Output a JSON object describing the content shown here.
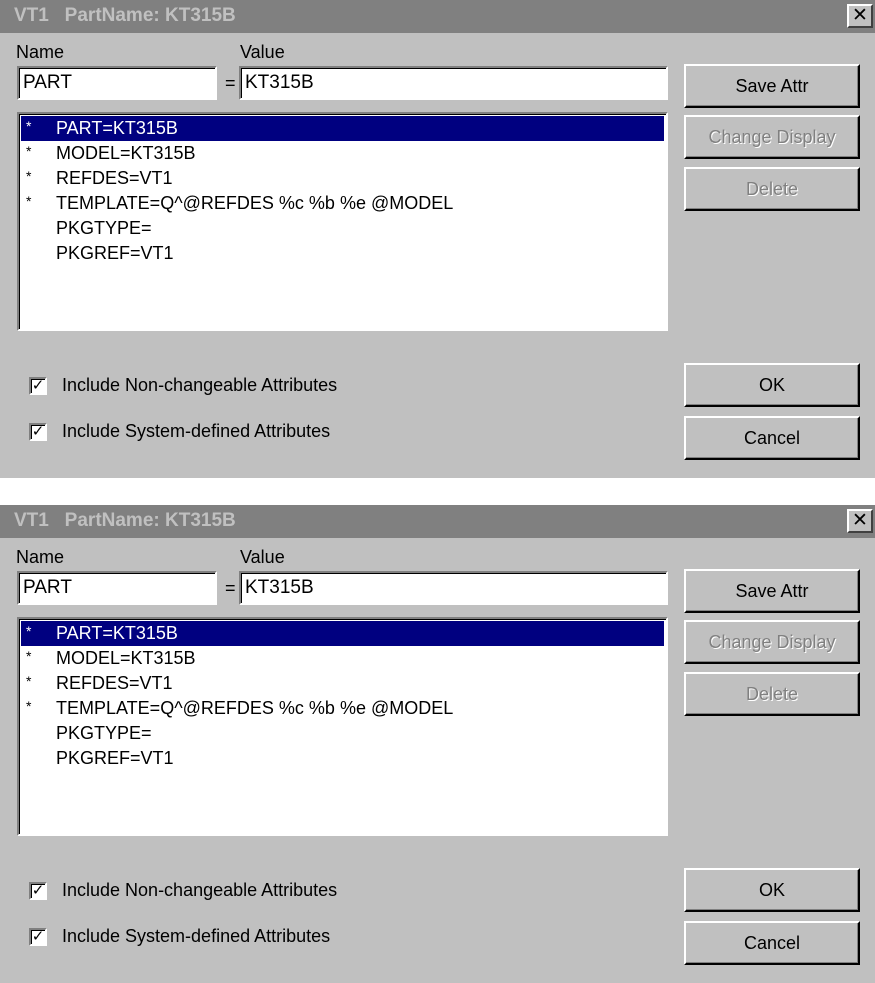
{
  "dialogs": [
    {
      "title": "VT1   PartName: KT315B",
      "close_glyph": "✕",
      "name_label": "Name",
      "value_label": "Value",
      "name_input": "PART",
      "equals": "=",
      "value_input": "KT315B",
      "attributes": [
        {
          "marker": "*",
          "text": "PART=KT315B",
          "selected": true
        },
        {
          "marker": "*",
          "text": "MODEL=KT315B",
          "selected": false
        },
        {
          "marker": "*",
          "text": "REFDES=VT1",
          "selected": false
        },
        {
          "marker": "*",
          "text": "TEMPLATE=Q^@REFDES %c %b %e @MODEL",
          "selected": false
        },
        {
          "marker": "",
          "text": "PKGTYPE=",
          "selected": false
        },
        {
          "marker": "",
          "text": "PKGREF=VT1",
          "selected": false
        }
      ],
      "buttons": {
        "save_attr": "Save Attr",
        "change_display": "Change Display",
        "delete": "Delete",
        "ok": "OK",
        "cancel": "Cancel"
      },
      "checkboxes": [
        {
          "label": "Include Non-changeable Attributes",
          "checked": true
        },
        {
          "label": "Include System-defined Attributes",
          "checked": true
        }
      ]
    },
    {
      "title": "VT1   PartName: KT315B",
      "close_glyph": "✕",
      "name_label": "Name",
      "value_label": "Value",
      "name_input": "PART",
      "equals": "=",
      "value_input": "KT315B",
      "attributes": [
        {
          "marker": "*",
          "text": "PART=KT315B",
          "selected": true
        },
        {
          "marker": "*",
          "text": "MODEL=KT315B",
          "selected": false
        },
        {
          "marker": "*",
          "text": "REFDES=VT1",
          "selected": false
        },
        {
          "marker": "*",
          "text": "TEMPLATE=Q^@REFDES %c %b %e @MODEL",
          "selected": false
        },
        {
          "marker": "",
          "text": "PKGTYPE=",
          "selected": false
        },
        {
          "marker": "",
          "text": "PKGREF=VT1",
          "selected": false
        }
      ],
      "buttons": {
        "save_attr": "Save Attr",
        "change_display": "Change Display",
        "delete": "Delete",
        "ok": "OK",
        "cancel": "Cancel"
      },
      "checkboxes": [
        {
          "label": "Include Non-changeable Attributes",
          "checked": true
        },
        {
          "label": "Include System-defined Attributes",
          "checked": true
        }
      ]
    }
  ]
}
